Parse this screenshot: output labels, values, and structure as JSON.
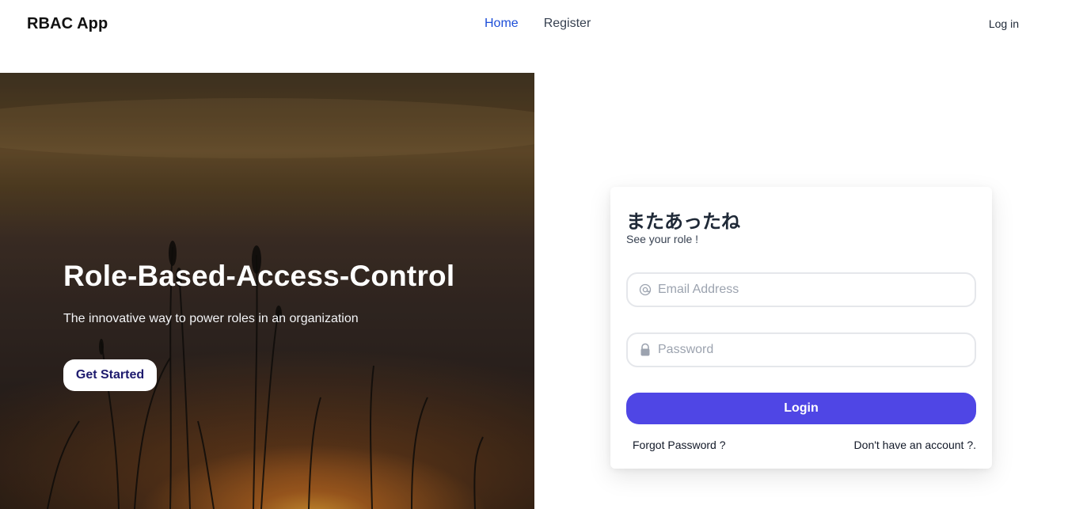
{
  "app": {
    "brand": "RBAC App",
    "nav": [
      {
        "label": "Home",
        "active": true
      },
      {
        "label": "Register",
        "active": false
      }
    ],
    "login_link": "Log in"
  },
  "hero": {
    "title": "Role-Based-Access-Control",
    "subtitle": "The innovative way to power roles in an organization",
    "cta": "Get Started"
  },
  "login_card": {
    "title": "またあったね",
    "subtitle": "See your role !",
    "email": {
      "placeholder": "Email Address",
      "value": "",
      "icon": "at-icon"
    },
    "password": {
      "placeholder": "Password",
      "value": "",
      "icon": "lock-icon"
    },
    "submit": "Login",
    "forgot": "Forgot Password ?",
    "no_account": "Don't have an account ?."
  },
  "colors": {
    "accent": "#4f46e5",
    "nav_active": "#1d4ed8",
    "cta_text": "#1e1b6e"
  }
}
